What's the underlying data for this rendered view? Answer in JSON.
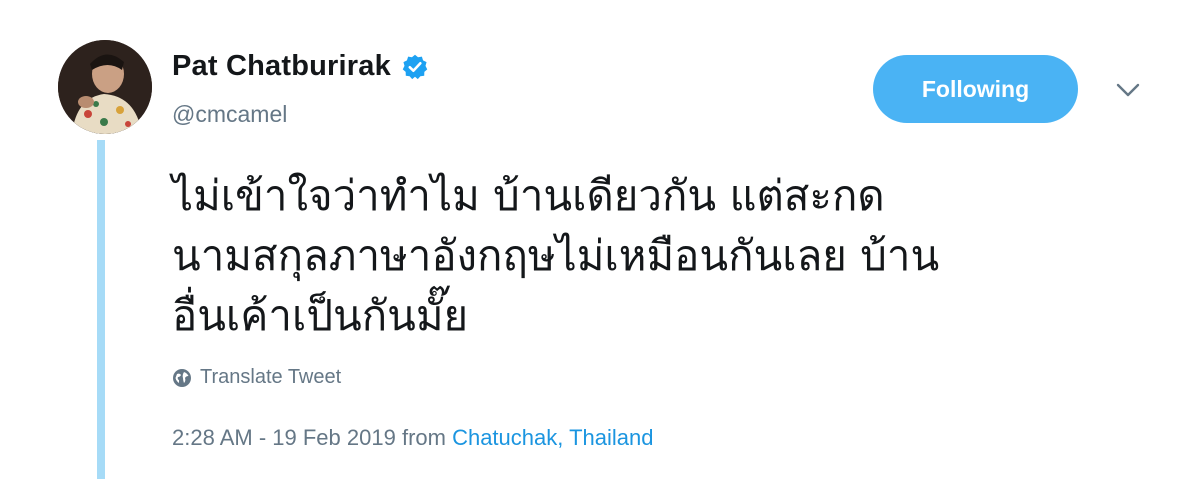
{
  "author": {
    "display_name": "Pat Chatburirak",
    "handle": "@cmcamel",
    "verified_icon": "verified-badge-icon",
    "avatar_icon": "profile-photo"
  },
  "actions": {
    "follow_label": "Following",
    "menu_icon": "chevron-down-icon"
  },
  "tweet": {
    "lines": [
      "ไม่เข้าใจว่าทำไม บ้านเดียวกัน แต่สะกด",
      "นามสกุลภาษาอังกฤษไม่เหมือนกันเลย บ้าน",
      "อื่นเค้าเป็นกันมั๊ย"
    ],
    "translate_label": "Translate Tweet",
    "translate_icon": "globe-icon",
    "timestamp": "2:28 AM - 19 Feb 2019",
    "from_label": "from",
    "location": "Chatuchak, Thailand"
  },
  "colors": {
    "accent": "#4ab3f4",
    "link": "#1b95e0",
    "secondary_text": "#657786",
    "thread_line": "#a6dbf7"
  }
}
